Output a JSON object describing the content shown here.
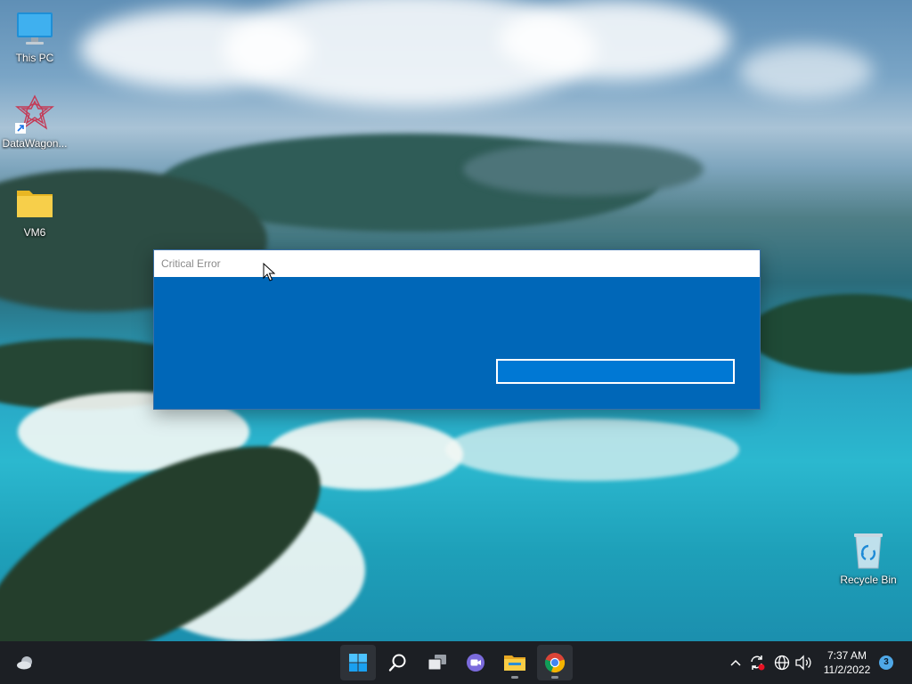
{
  "desktop": {
    "icons": [
      {
        "label": "This PC",
        "icon": "monitor-icon"
      },
      {
        "label": "DataWagon...",
        "icon": "datawagon-app-icon"
      },
      {
        "label": "VM6",
        "icon": "folder-icon"
      },
      {
        "label": "Recycle Bin",
        "icon": "recycle-bin-icon"
      }
    ]
  },
  "dialog": {
    "title": "Critical Error",
    "button_label": "",
    "colors": {
      "titlebar": "#ffffff",
      "body": "#0067b8",
      "button": "#0078d4"
    }
  },
  "taskbar": {
    "widgets_icon": "weather-widget-icon",
    "apps": [
      {
        "name": "Start",
        "icon": "windows-start-icon"
      },
      {
        "name": "Search",
        "icon": "search-icon"
      },
      {
        "name": "Task View",
        "icon": "task-view-icon"
      },
      {
        "name": "Chat",
        "icon": "chat-icon"
      },
      {
        "name": "File Explorer",
        "icon": "file-explorer-icon"
      },
      {
        "name": "Google Chrome",
        "icon": "chrome-icon"
      }
    ],
    "tray": {
      "time": "7:37 AM",
      "date": "11/2/2022",
      "notification_count": "3"
    }
  }
}
